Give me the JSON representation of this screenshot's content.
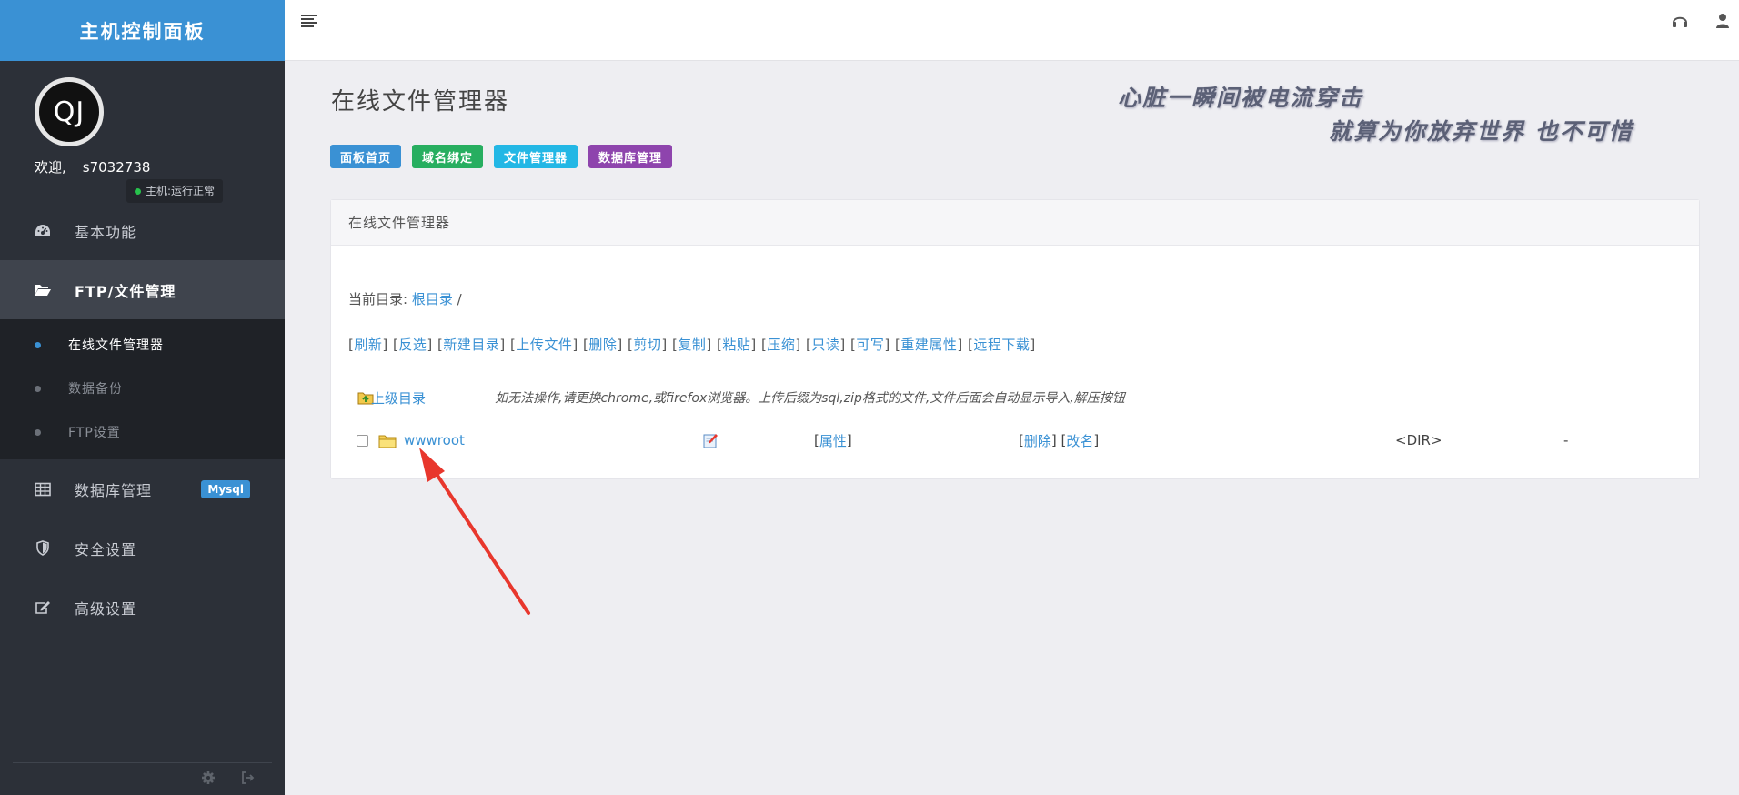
{
  "brand": {
    "title": "主机控制面板"
  },
  "profile": {
    "avatar_text": "QJ",
    "welcome": "欢迎,",
    "username": "s7032738",
    "status": "主机:运行正常"
  },
  "sidebar": {
    "items": [
      {
        "label": "基本功能",
        "icon": "dashboard-icon"
      },
      {
        "label": "FTP/文件管理",
        "icon": "folder-open-icon"
      },
      {
        "label": "数据库管理",
        "icon": "table-icon",
        "badge": "Mysql"
      },
      {
        "label": "安全设置",
        "icon": "shield-icon"
      },
      {
        "label": "高级设置",
        "icon": "edit-icon"
      }
    ],
    "submenu": [
      {
        "label": "在线文件管理器"
      },
      {
        "label": "数据备份"
      },
      {
        "label": "FTP设置"
      }
    ]
  },
  "page": {
    "title": "在线文件管理器",
    "quote_line1": "心脏一瞬间被电流穿击",
    "quote_line2": "就算为你放弃世界 也不可惜"
  },
  "quick_links": [
    {
      "label": "面板首页",
      "color": "#3a91d4"
    },
    {
      "label": "域名绑定",
      "color": "#27ae60"
    },
    {
      "label": "文件管理器",
      "color": "#23b7e5"
    },
    {
      "label": "数据库管理",
      "color": "#8e44ad"
    }
  ],
  "panel": {
    "heading": "在线文件管理器",
    "curdir_label": "当前目录:",
    "curdir_root": "根目录",
    "curdir_sep": "/",
    "actions": [
      "刷新",
      "反选",
      "新建目录",
      "上传文件",
      "删除",
      "剪切",
      "复制",
      "粘贴",
      "压缩",
      "只读",
      "可写",
      "重建属性",
      "远程下载"
    ],
    "parent_dir": "上级目录",
    "hint": "如无法操作,请更换chrome,或firefox浏览器。上传后缀为sql,zip格式的文件,文件后面会自动显示导入,解压按钮",
    "files": [
      {
        "name": "wwwroot",
        "props": "属性",
        "delete": "删除",
        "rename": "改名",
        "type": "<DIR>",
        "size": "-"
      }
    ]
  },
  "colors": {
    "accent": "#3a91d4",
    "sidebar_bg": "#2c3038",
    "annotation_arrow": "#e8372d"
  }
}
